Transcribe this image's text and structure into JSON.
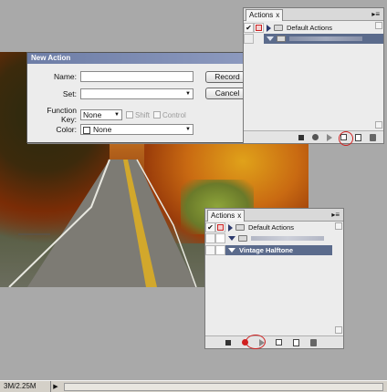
{
  "statusbar": {
    "doc_size": "3M/2.25M"
  },
  "dialog": {
    "title": "New Action",
    "name_label": "Name:",
    "name_value": "",
    "set_label": "Set:",
    "set_value": "",
    "function_key_label": "Function Key:",
    "function_key_value": "None",
    "shift_label": "Shift",
    "control_label": "Control",
    "color_label": "Color:",
    "color_value": "None",
    "record_button": "Record",
    "cancel_button": "Cancel"
  },
  "actions_panel_top": {
    "tab_label": "Actions",
    "tab_close": "x",
    "rows": [
      {
        "label": "Default Actions"
      },
      {
        "label": ""
      }
    ]
  },
  "actions_panel_bottom": {
    "tab_label": "Actions",
    "tab_close": "x",
    "rows": [
      {
        "label": "Default Actions"
      },
      {
        "label": ""
      },
      {
        "label": "Vintage Halftone"
      }
    ]
  },
  "colors": {
    "record_highlight": "#d02020",
    "selection": "#5b6b8c",
    "dialog_title": "#6d7da6"
  }
}
